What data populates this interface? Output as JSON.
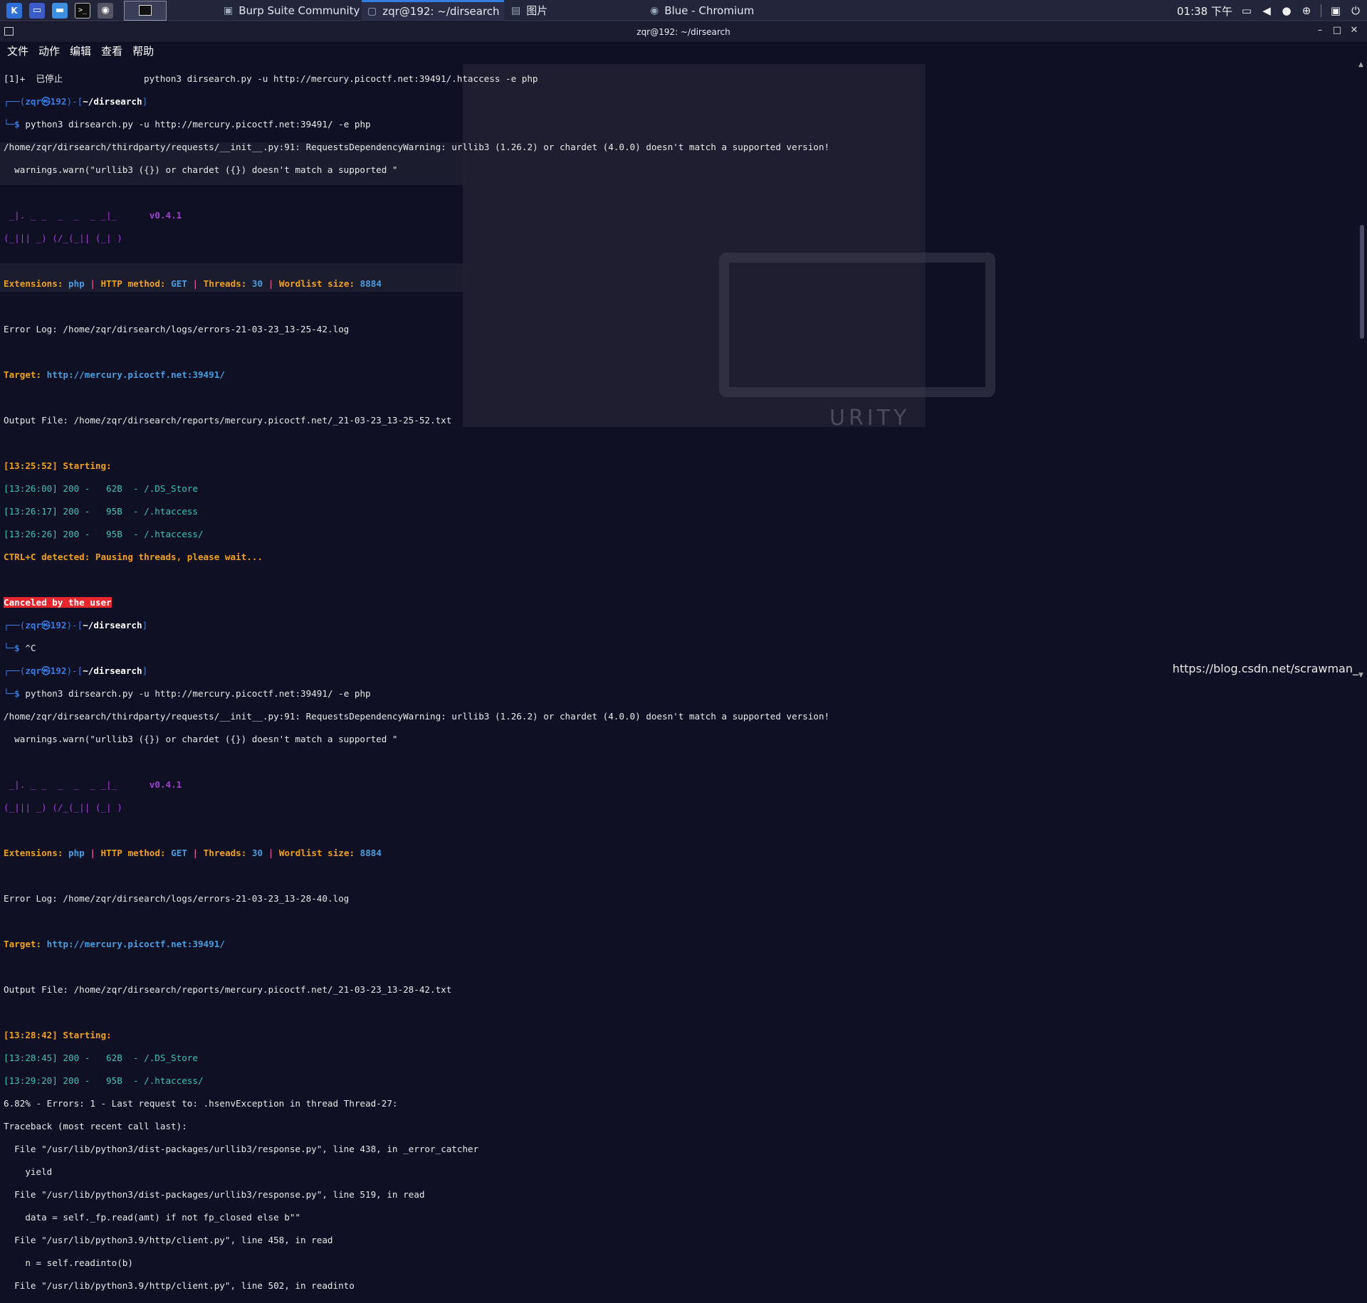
{
  "taskbar": {
    "tasks": [
      {
        "label": "Burp Suite Community E..."
      },
      {
        "label": "zqr@192: ~/dirsearch"
      },
      {
        "label": "图片"
      },
      {
        "label": "Blue - Chromium"
      }
    ],
    "clock": "01:38 下午"
  },
  "window": {
    "title": "zqr@192: ~/dirsearch"
  },
  "menu": {
    "items": [
      "文件",
      "动作",
      "编辑",
      "查看",
      "帮助"
    ]
  },
  "prompt": {
    "user": "zqr㉿192",
    "path": "~/dirsearch",
    "symbol": "$"
  },
  "terminal": {
    "stopped_line": "[1]+  已停止               python3 dirsearch.py -u http://mercury.picoctf.net:39491/.htaccess -e php",
    "cmd1": "python3 dirsearch.py -u http://mercury.picoctf.net:39491/ -e php",
    "warn1": "/home/zqr/dirsearch/thirdparty/requests/__init__.py:91: RequestsDependencyWarning: urllib3 (1.26.2) or chardet (4.0.0) doesn't match a supported version!",
    "warn2": "  warnings.warn(\"urllib3 ({}) or chardet ({}) doesn't match a supported \"",
    "logo_line1": " _|. _ _  _  _  _ _|_    ",
    "logo_line2": "(_||| _) (/_(_|| (_| )   ",
    "version": "v0.4.1",
    "ext_label": "Extensions:",
    "ext_value": "php",
    "method_label": "HTTP method:",
    "method_value": "GET",
    "threads_label": "Threads:",
    "threads_value": "30",
    "wordlist_label": "Wordlist size:",
    "wordlist_value": "8884",
    "errorlog1": "Error Log: /home/zqr/dirsearch/logs/errors-21-03-23_13-25-42.log",
    "target_label": "Target:",
    "target_value": "http://mercury.picoctf.net:39491/",
    "output1": "Output File: /home/zqr/dirsearch/reports/mercury.picoctf.net/_21-03-23_13-25-52.txt",
    "starting1": "[13:25:52] Starting:",
    "hits1": [
      "[13:26:00] 200 -   62B  - /.DS_Store",
      "[13:26:17] 200 -   95B  - /.htaccess",
      "[13:26:26] 200 -   95B  - /.htaccess/"
    ],
    "ctrlc": "CTRL+C detected: Pausing threads, please wait...",
    "canceled": "Canceled by the user",
    "ctrl_c_input": "^C",
    "cmd2": "python3 dirsearch.py -u http://mercury.picoctf.net:39491/ -e php",
    "errorlog2": "Error Log: /home/zqr/dirsearch/logs/errors-21-03-23_13-28-40.log",
    "output2": "Output File: /home/zqr/dirsearch/reports/mercury.picoctf.net/_21-03-23_13-28-42.txt",
    "starting2": "[13:28:42] Starting:",
    "hits2": [
      "[13:28:45] 200 -   62B  - /.DS_Store",
      "[13:29:20] 200 -   95B  - /.htaccess/"
    ],
    "trace": [
      "6.82% - Errors: 1 - Last request to: .hsenvException in thread Thread-27:",
      "Traceback (most recent call last):",
      "  File \"/usr/lib/python3/dist-packages/urllib3/response.py\", line 438, in _error_catcher",
      "    yield",
      "  File \"/usr/lib/python3/dist-packages/urllib3/response.py\", line 519, in read",
      "    data = self._fp.read(amt) if not fp_closed else b\"\"",
      "  File \"/usr/lib/python3.9/http/client.py\", line 458, in read",
      "    n = self.readinto(b)",
      "  File \"/usr/lib/python3.9/http/client.py\", line 502, in readinto"
    ]
  },
  "watermark": "https://blog.csdn.net/scrawman_",
  "bg_word": "URITY"
}
